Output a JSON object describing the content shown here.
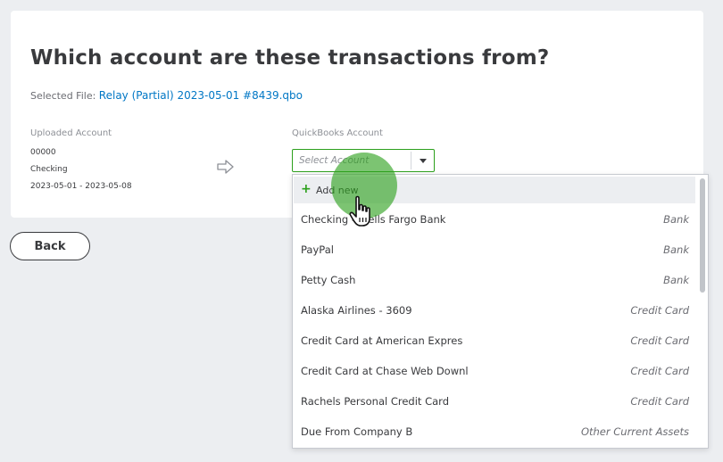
{
  "page": {
    "title": "Which account are these transactions from?",
    "selected_file_label": "Selected File:",
    "selected_file_name": "Relay (Partial) 2023-05-01 #8439.qbo"
  },
  "uploaded_account": {
    "header": "Uploaded Account",
    "number": "00000",
    "type": "Checking",
    "date_range": "2023-05-01 - 2023-05-08"
  },
  "quickbooks_account": {
    "header": "QuickBooks Account",
    "placeholder": "Select Account"
  },
  "dropdown": {
    "add_new_label": "Add new",
    "items": [
      {
        "name": "Checking - Wells Fargo Bank",
        "type": "Bank"
      },
      {
        "name": "PayPal",
        "type": "Bank"
      },
      {
        "name": "Petty Cash",
        "type": "Bank"
      },
      {
        "name": "Alaska Airlines - 3609",
        "type": "Credit Card"
      },
      {
        "name": "Credit Card at American Expres",
        "type": "Credit Card"
      },
      {
        "name": "Credit Card at Chase Web Downl",
        "type": "Credit Card"
      },
      {
        "name": "Rachels Personal Credit Card",
        "type": "Credit Card"
      },
      {
        "name": "Due From Company B",
        "type": "Other Current Assets"
      }
    ]
  },
  "buttons": {
    "back_label": "Back"
  },
  "colors": {
    "accent_green": "#2ca01c",
    "link_blue": "#0077c5",
    "text_dark": "#393a3d",
    "page_background": "#eceef1",
    "highlight_row": "#eceef1"
  },
  "icons": {
    "arrow": "right-arrow-icon",
    "caret": "chevron-down-icon",
    "plus": "plus-icon",
    "cursor": "hand-pointer-icon"
  }
}
